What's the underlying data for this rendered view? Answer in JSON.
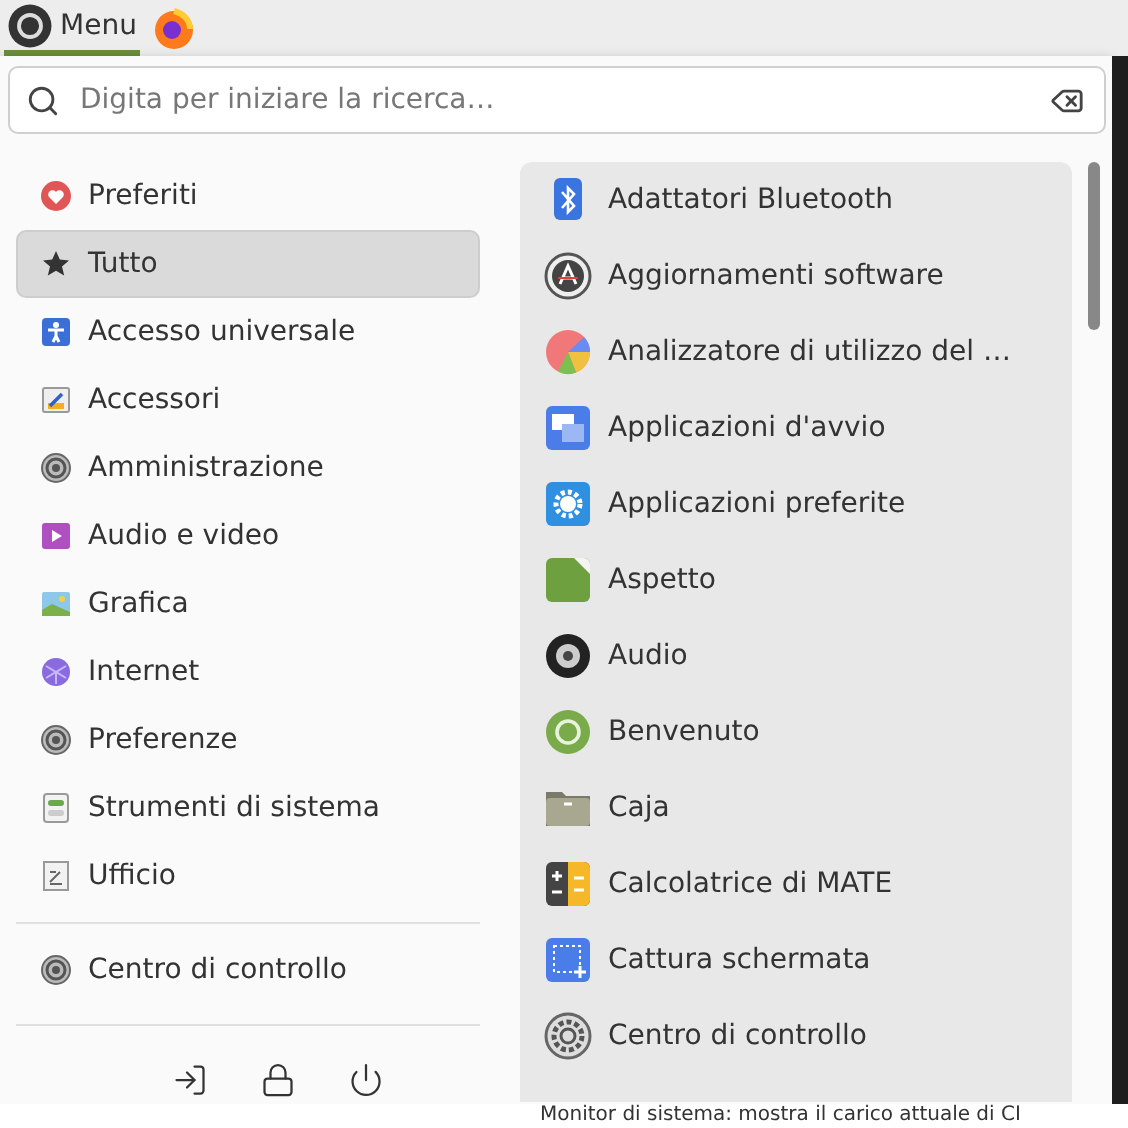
{
  "panel": {
    "menu_label": "Menu",
    "underline": true
  },
  "search": {
    "placeholder": "Digita per iniziare la ricerca…"
  },
  "categories": [
    {
      "label": "Preferiti",
      "selected": false
    },
    {
      "label": "Tutto",
      "selected": true
    },
    {
      "label": "Accesso universale",
      "selected": false
    },
    {
      "label": "Accessori",
      "selected": false
    },
    {
      "label": "Amministrazione",
      "selected": false
    },
    {
      "label": "Audio e video",
      "selected": false
    },
    {
      "label": "Grafica",
      "selected": false
    },
    {
      "label": "Internet",
      "selected": false
    },
    {
      "label": "Preferenze",
      "selected": false
    },
    {
      "label": "Strumenti di sistema",
      "selected": false
    },
    {
      "label": "Ufficio",
      "selected": false
    }
  ],
  "control_center": {
    "label": "Centro di controllo"
  },
  "apps": [
    {
      "label": "Adattatori Bluetooth"
    },
    {
      "label": "Aggiornamenti software"
    },
    {
      "label": "Analizzatore di utilizzo del …"
    },
    {
      "label": "Applicazioni d'avvio"
    },
    {
      "label": "Applicazioni preferite"
    },
    {
      "label": "Aspetto"
    },
    {
      "label": "Audio"
    },
    {
      "label": "Benvenuto"
    },
    {
      "label": "Caja"
    },
    {
      "label": "Calcolatrice di MATE"
    },
    {
      "label": "Cattura schermata"
    },
    {
      "label": "Centro di controllo"
    }
  ],
  "background_text": "Monitor di sistema: mostra il carico attuale di CI"
}
